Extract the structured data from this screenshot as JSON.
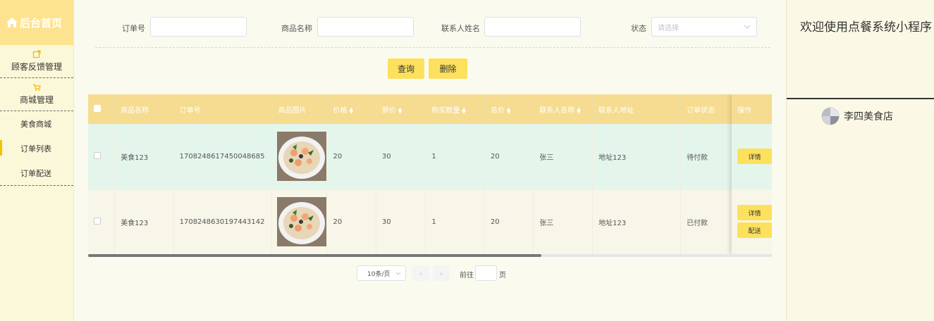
{
  "sidebar": {
    "logo": "后台首页",
    "menu": [
      {
        "label": "顾客反馈管理",
        "icon": "note-icon"
      },
      {
        "label": "商城管理",
        "icon": "cart-icon"
      }
    ],
    "submenu": [
      {
        "label": "美食商城",
        "active": false
      },
      {
        "label": "订单列表",
        "active": true
      },
      {
        "label": "订单配送",
        "active": false
      }
    ]
  },
  "filter": {
    "order_no_label": "订单号",
    "order_no_value": "",
    "product_label": "商品名称",
    "product_value": "",
    "contact_label": "联系人姓名",
    "contact_value": "",
    "status_label": "状态",
    "status_placeholder": "请选择",
    "search_button": "查询",
    "delete_button": "删除"
  },
  "table": {
    "columns": [
      "商品名称",
      "订单号",
      "商品图片",
      "价格",
      "原价",
      "购买数量",
      "总价",
      "联系人名称",
      "联系人地址",
      "订单状态",
      "操作"
    ],
    "rows": [
      {
        "product": "美食123",
        "order_no": "1708248617450048685",
        "price": "20",
        "original_price": "30",
        "quantity": "1",
        "total": "20",
        "contact": "张三",
        "address": "地址123",
        "status": "待付款",
        "actions": [
          "详情"
        ]
      },
      {
        "product": "美食123",
        "order_no": "1708248630197443142",
        "price": "20",
        "original_price": "30",
        "quantity": "1",
        "total": "20",
        "contact": "张三",
        "address": "地址123",
        "status": "已付款",
        "actions": [
          "详情",
          "配送"
        ]
      }
    ]
  },
  "pagination": {
    "page_size": "10条/页",
    "goto_label": "前往",
    "page_suffix": "页"
  },
  "right_panel": {
    "welcome": "欢迎使用点餐系统小程序",
    "user_name": "李四美食店"
  },
  "colors": {
    "accent": "#fde05d",
    "header_bg": "#f6dc90",
    "logo_bg": "#fde38f"
  }
}
